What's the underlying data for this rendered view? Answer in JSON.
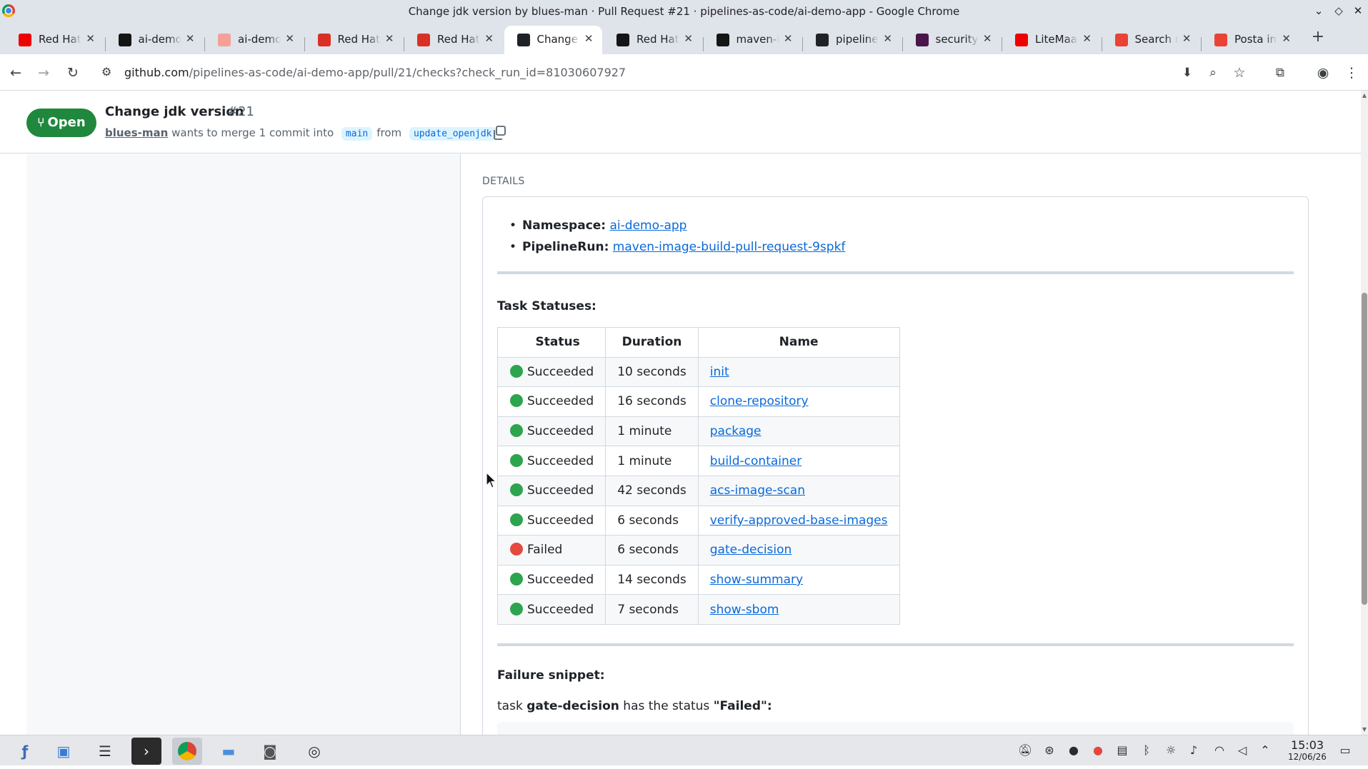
{
  "window": {
    "title": "Change jdk version by blues-man · Pull Request #21 · pipelines-as-code/ai-demo-app - Google Chrome"
  },
  "tabs": [
    {
      "label": "Red Hat",
      "icon": "redhat-icon",
      "color": "#ee0000"
    },
    {
      "label": "ai-demo",
      "icon": "app-icon",
      "color": "#151515"
    },
    {
      "label": "ai-demo",
      "icon": "avatar-icon",
      "color": "#f5a097"
    },
    {
      "label": "Red Hat",
      "icon": "doc-icon",
      "color": "#d93025"
    },
    {
      "label": "Red Hat",
      "icon": "doc-icon",
      "color": "#d93025"
    },
    {
      "label": "Change",
      "icon": "github-icon",
      "color": "#1f2328",
      "active": true
    },
    {
      "label": "Red Hat",
      "icon": "app-icon",
      "color": "#151515"
    },
    {
      "label": "maven-i",
      "icon": "app-icon",
      "color": "#151515"
    },
    {
      "label": "pipeline",
      "icon": "github-icon",
      "color": "#1f2328"
    },
    {
      "label": "security",
      "icon": "slack-icon",
      "color": "#4a154b"
    },
    {
      "label": "LiteMaa",
      "icon": "redhat-icon",
      "color": "#ee0000"
    },
    {
      "label": "Search r",
      "icon": "gmail-icon",
      "color": "#ea4335"
    },
    {
      "label": "Posta in",
      "icon": "gmail-icon",
      "color": "#ea4335"
    }
  ],
  "omnibox": {
    "host": "github.com",
    "path": "/pipelines-as-code/ai-demo-app/pull/21/checks?check_run_id=81030607927"
  },
  "pr": {
    "state": "Open",
    "title": "Change jdk version",
    "number": "#21",
    "author": "blues-man",
    "merge_text": "wants to merge 1 commit into",
    "base_branch": "main",
    "from_text": "from",
    "head_branch": "update_openjdk"
  },
  "details": {
    "label": "DETAILS",
    "namespace_key": "Namespace:",
    "namespace_value": "ai-demo-app",
    "pipelinerun_key": "PipelineRun:",
    "pipelinerun_value": "maven-image-build-pull-request-9spkf",
    "task_statuses_title": "Task Statuses:",
    "columns": [
      "Status",
      "Duration",
      "Name"
    ],
    "rows": [
      {
        "status": "Succeeded",
        "duration": "10 seconds",
        "name": "init"
      },
      {
        "status": "Succeeded",
        "duration": "16 seconds",
        "name": "clone-repository"
      },
      {
        "status": "Succeeded",
        "duration": "1 minute",
        "name": "package"
      },
      {
        "status": "Succeeded",
        "duration": "1 minute",
        "name": "build-container"
      },
      {
        "status": "Succeeded",
        "duration": "42 seconds",
        "name": "acs-image-scan"
      },
      {
        "status": "Succeeded",
        "duration": "6 seconds",
        "name": "verify-approved-base-images"
      },
      {
        "status": "Failed",
        "duration": "6 seconds",
        "name": "gate-decision"
      },
      {
        "status": "Succeeded",
        "duration": "14 seconds",
        "name": "show-summary"
      },
      {
        "status": "Succeeded",
        "duration": "7 seconds",
        "name": "show-sbom"
      }
    ],
    "status_colors": {
      "Succeeded": "#2da44e",
      "Failed": "#e5483f"
    },
    "failure_title": "Failure snippet:",
    "failure_prefix": "task",
    "failure_task": "gate-decision",
    "failure_mid": "has the status",
    "failure_status": "\"Failed\":"
  },
  "taskbar": {
    "time": "15:03",
    "date": "12/06/26"
  },
  "colors": {
    "accent": "#0969da",
    "open_green": "#1f883d"
  }
}
